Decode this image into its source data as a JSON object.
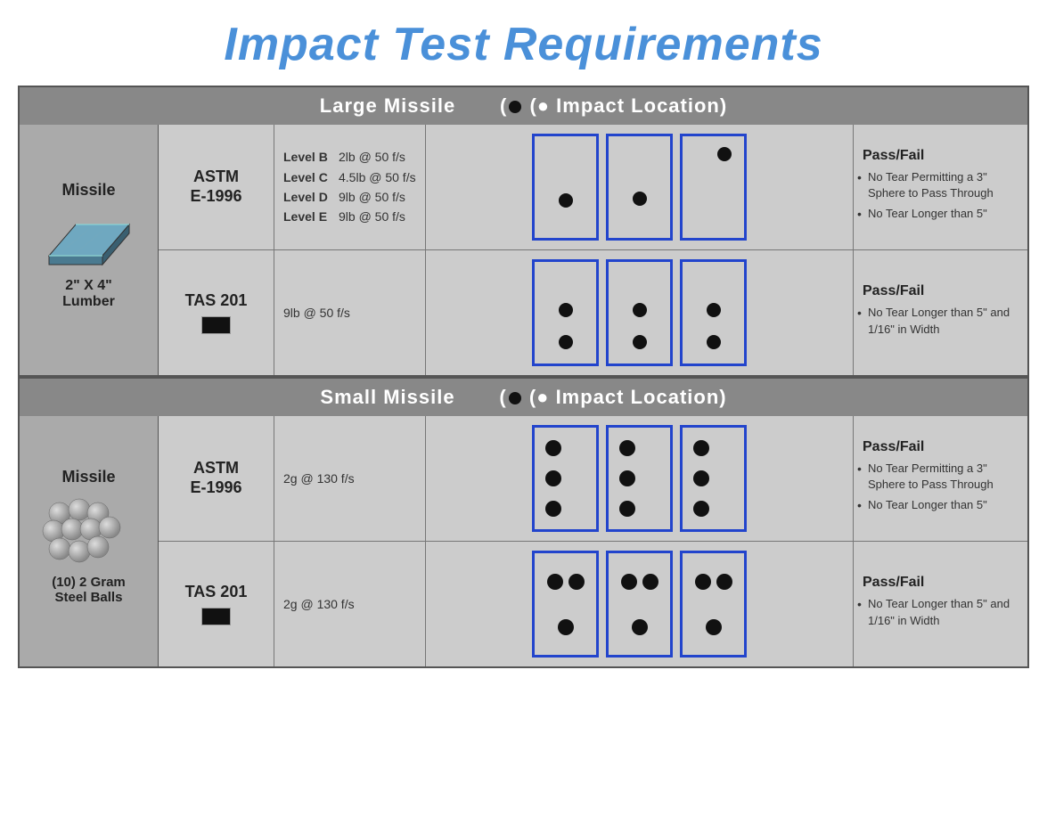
{
  "title": "Impact Test Requirements",
  "large_missile_header": "Large Missile",
  "large_missile_impact": "(● Impact Location)",
  "small_missile_header": "Small Missile",
  "small_missile_impact": "(● Impact Location)",
  "missile_label": "Missile",
  "lumber_size": "2\" X 4\"\nLumber",
  "lumber_size_line1": "2\" X 4\"",
  "lumber_size_line2": "Lumber",
  "balls_label_line1": "(10) 2 Gram",
  "balls_label_line2": "Steel Balls",
  "large_row1": {
    "standard": "ASTM\nE-1996",
    "standard_line1": "ASTM",
    "standard_line2": "E-1996",
    "levels": [
      {
        "name": "Level B",
        "value": "2lb @ 50 f/s"
      },
      {
        "name": "Level C",
        "value": "4.5lb @ 50 f/s"
      },
      {
        "name": "Level D",
        "value": "9lb @ 50 f/s"
      },
      {
        "name": "Level E",
        "value": "9lb @ 50 f/s"
      }
    ],
    "passfail_title": "Pass/Fail",
    "passfail_items": [
      "No Tear Permitting a 3\" Sphere to Pass Through",
      "No Tear Longer than 5\""
    ]
  },
  "large_row2": {
    "standard_line1": "TAS 201",
    "value": "9lb @ 50 f/s",
    "passfail_title": "Pass/Fail",
    "passfail_items": [
      "No Tear Longer than 5\" and 1/16\" in Width"
    ]
  },
  "small_row1": {
    "standard_line1": "ASTM",
    "standard_line2": "E-1996",
    "value": "2g @ 130 f/s",
    "passfail_title": "Pass/Fail",
    "passfail_items": [
      "No Tear Permitting a 3\" Sphere to Pass Through",
      "No Tear Longer than 5\""
    ]
  },
  "small_row2": {
    "standard_line1": "TAS 201",
    "value": "2g @ 130 f/s",
    "passfail_title": "Pass/Fail",
    "passfail_items": [
      "No Tear Longer than 5\" and 1/16\" in Width"
    ]
  }
}
